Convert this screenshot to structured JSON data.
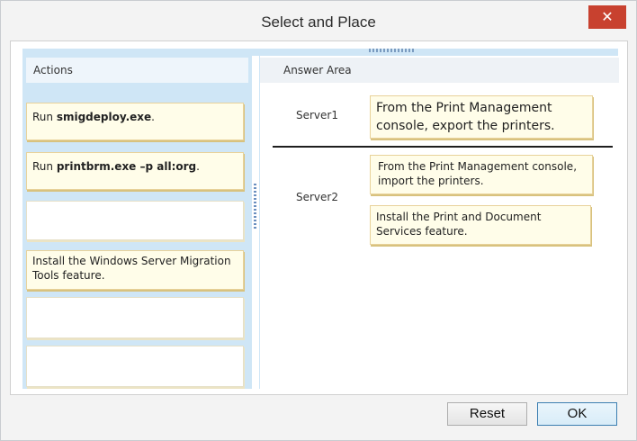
{
  "window": {
    "title": "Select and Place",
    "close_glyph": "✕"
  },
  "actions": {
    "header": "Actions",
    "items": [
      {
        "prefix": "Run ",
        "bold": "smigdeploy.exe",
        "suffix": "."
      },
      {
        "prefix": "Run ",
        "bold": "printbrm.exe –p all:org",
        "suffix": "."
      },
      {
        "text": ""
      },
      {
        "text": "Install the Windows Server Migration Tools feature."
      },
      {
        "text": ""
      },
      {
        "text": ""
      }
    ]
  },
  "answer_area": {
    "header": "Answer Area",
    "server1": {
      "label": "Server1",
      "cards": [
        "From the Print Management console, export the printers."
      ]
    },
    "server2": {
      "label": "Server2",
      "cards": [
        "From the Print Management console, import the printers.",
        "Install the Print and Document Services feature."
      ]
    }
  },
  "buttons": {
    "reset": "Reset",
    "ok": "OK"
  },
  "colors": {
    "accent_close": "#c8412f",
    "pane_blue": "#cfe6f6",
    "card_fill": "#fffde9",
    "card_border": "#e8d29a"
  }
}
